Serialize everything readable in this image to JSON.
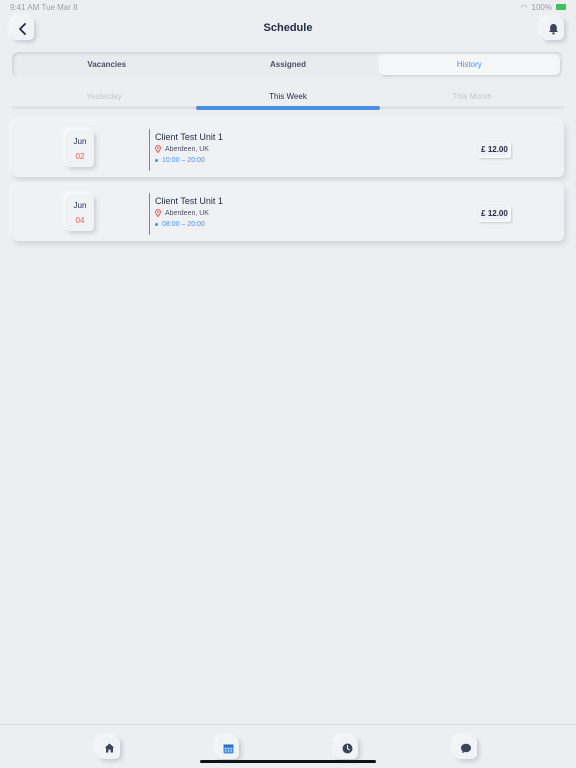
{
  "status_bar": {
    "left": "9:41 AM Tue Mar 8",
    "right": "100%"
  },
  "header": {
    "title": "Schedule"
  },
  "segments": [
    {
      "label": "Vacancies",
      "active": false
    },
    {
      "label": "Assigned",
      "active": false
    },
    {
      "label": "History",
      "active": true
    }
  ],
  "periods": [
    {
      "label": "Yesterday",
      "active": false
    },
    {
      "label": "This Week",
      "active": true
    },
    {
      "label": "This Month",
      "active": false
    }
  ],
  "shifts": [
    {
      "month": "Jun",
      "day": "02",
      "title": "Client Test Unit 1",
      "location": "Aberdeen, UK",
      "time": "10:00 – 20:00",
      "price": "£ 12.00"
    },
    {
      "month": "Jun",
      "day": "04",
      "title": "Client Test Unit 1",
      "location": "Aberdeen, UK",
      "time": "08:00 – 20:00",
      "price": "£ 12.00"
    }
  ],
  "nav": [
    "home-icon",
    "calendar-icon",
    "clock-icon",
    "chat-icon"
  ],
  "colors": {
    "accent": "#4a90e2",
    "date_day": "#e35d4f",
    "pin": "#e35d4f",
    "background": "#eceef2"
  }
}
